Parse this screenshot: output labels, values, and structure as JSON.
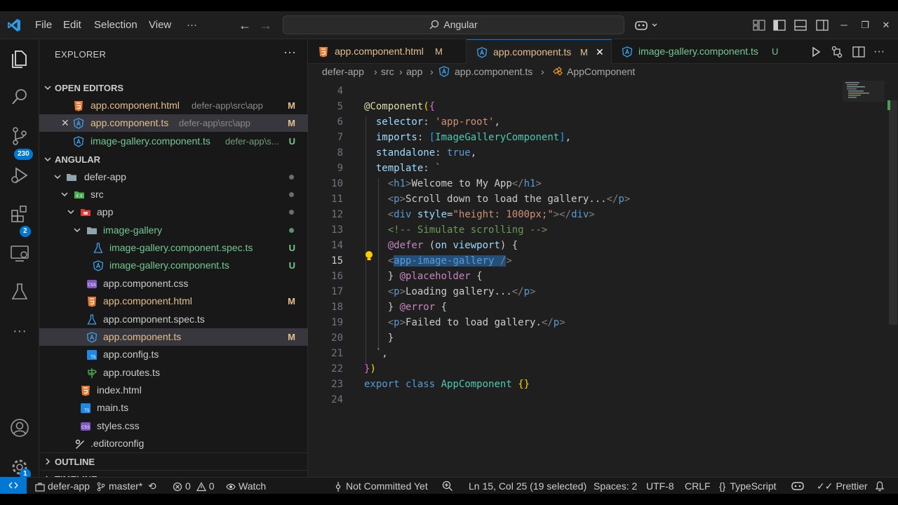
{
  "menu": {
    "file": "File",
    "edit": "Edit",
    "selection": "Selection",
    "view": "View",
    "more": "···"
  },
  "command_center": "Angular",
  "activity": {
    "source_control_badge": "230",
    "extensions_badge": "2",
    "settings_badge": "1"
  },
  "sidebar": {
    "title": "EXPLORER",
    "open_editors": {
      "label": "OPEN EDITORS",
      "items": [
        {
          "name": "app.component.html",
          "path": "defer-app\\src\\app",
          "status": "M"
        },
        {
          "name": "app.component.ts",
          "path": "defer-app\\src\\app",
          "status": "M"
        },
        {
          "name": "image-gallery.component.ts",
          "path": "defer-app\\s...",
          "status": "U"
        }
      ]
    },
    "workspace": {
      "label": "ANGULAR",
      "tree": [
        {
          "name": "defer-app"
        },
        {
          "name": "src"
        },
        {
          "name": "app"
        },
        {
          "name": "image-gallery"
        },
        {
          "name": "image-gallery.component.spec.ts",
          "status": "U"
        },
        {
          "name": "image-gallery.component.ts",
          "status": "U"
        },
        {
          "name": "app.component.css"
        },
        {
          "name": "app.component.html",
          "status": "M"
        },
        {
          "name": "app.component.spec.ts"
        },
        {
          "name": "app.component.ts",
          "status": "M"
        },
        {
          "name": "app.config.ts"
        },
        {
          "name": "app.routes.ts"
        },
        {
          "name": "index.html"
        },
        {
          "name": "main.ts"
        },
        {
          "name": "styles.css"
        },
        {
          "name": ".editorconfig"
        }
      ]
    },
    "outline": "OUTLINE",
    "timeline": "TIMELINE"
  },
  "tabs": [
    {
      "label": "app.component.html",
      "status": "M"
    },
    {
      "label": "app.component.ts",
      "status": "M"
    },
    {
      "label": "image-gallery.component.ts",
      "status": "U"
    }
  ],
  "breadcrumbs": [
    "defer-app",
    "src",
    "app",
    "app.component.ts",
    "AppComponent"
  ],
  "line_numbers": [
    "4",
    "5",
    "6",
    "7",
    "8",
    "9",
    "10",
    "11",
    "12",
    "13",
    "14",
    "15",
    "16",
    "17",
    "18",
    "19",
    "20",
    "21",
    "22",
    "23",
    "24"
  ],
  "status_bar": {
    "folder": "defer-app",
    "branch": "master*",
    "errors": "0",
    "warnings": "0",
    "watch": "Watch",
    "commit": "Not Committed Yet",
    "cursor": "Ln 15, Col 25 (19 selected)",
    "spaces": "Spaces: 2",
    "encoding": "UTF-8",
    "eol": "CRLF",
    "language": "TypeScript",
    "prettier": "Prettier"
  },
  "colors": {
    "accent": "#0078d4",
    "modified": "#e2c08d",
    "untracked": "#73c991",
    "angular": "#dd0031"
  }
}
